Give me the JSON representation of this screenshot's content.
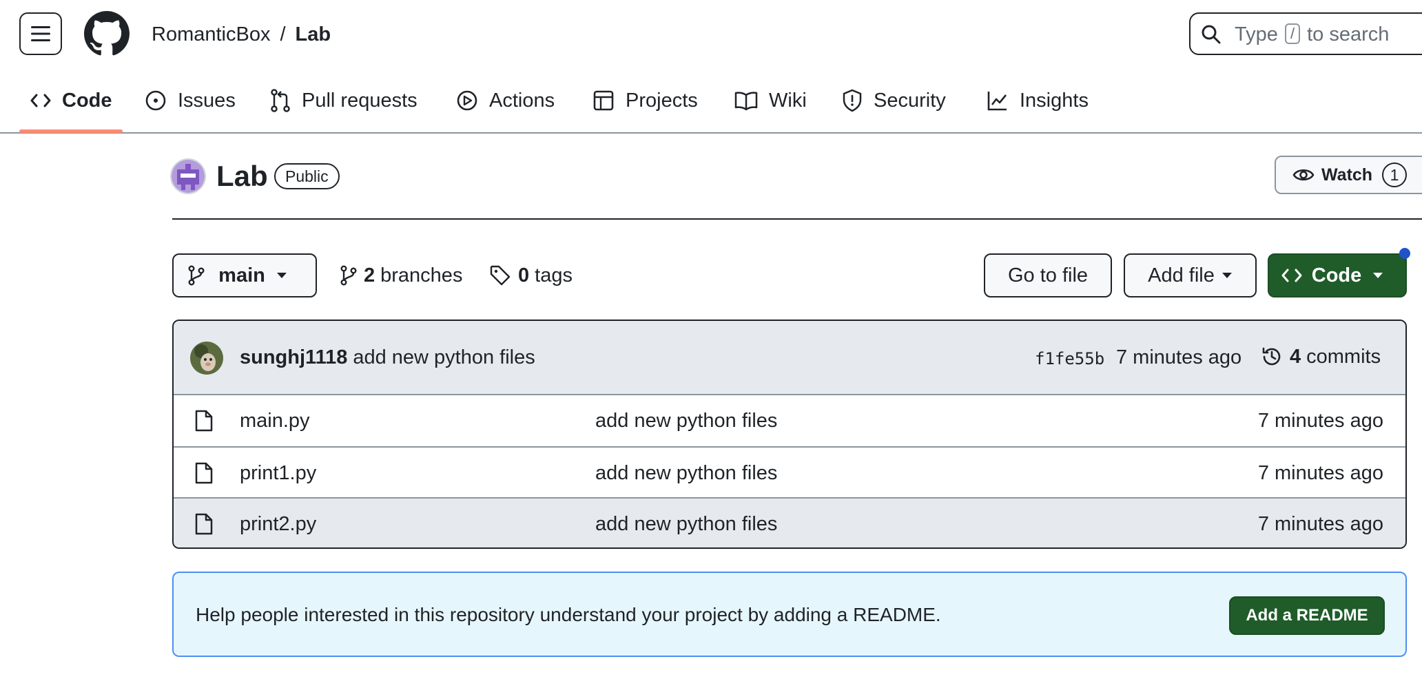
{
  "header": {
    "owner": "RomanticBox",
    "separator": "/",
    "repo": "Lab",
    "search_before": "Type",
    "search_key": "/",
    "search_after": "to search"
  },
  "tabs": [
    {
      "label": "Code",
      "icon": "code-icon",
      "active": true
    },
    {
      "label": "Issues",
      "icon": "issue-opened-icon"
    },
    {
      "label": "Pull requests",
      "icon": "git-pull-request-icon"
    },
    {
      "label": "Actions",
      "icon": "play-icon"
    },
    {
      "label": "Projects",
      "icon": "table-icon"
    },
    {
      "label": "Wiki",
      "icon": "book-icon"
    },
    {
      "label": "Security",
      "icon": "shield-icon"
    },
    {
      "label": "Insights",
      "icon": "graph-icon"
    }
  ],
  "repo": {
    "name": "Lab",
    "visibility": "Public",
    "watch_label": "Watch",
    "watch_count": "1"
  },
  "toolbar": {
    "branch": "main",
    "branches_count": "2",
    "branches_label": "branches",
    "tags_count": "0",
    "tags_label": "tags",
    "goto_file": "Go to file",
    "add_file": "Add file",
    "code": "Code"
  },
  "latest_commit": {
    "author": "sunghj1118",
    "message": "add new python files",
    "sha": "f1fe55b",
    "time": "7 minutes ago",
    "commits_count": "4",
    "commits_label": "commits"
  },
  "files": [
    {
      "name": "main.py",
      "message": "add new python files",
      "time": "7 minutes ago"
    },
    {
      "name": "print1.py",
      "message": "add new python files",
      "time": "7 minutes ago"
    },
    {
      "name": "print2.py",
      "message": "add new python files",
      "time": "7 minutes ago"
    }
  ],
  "readme_banner": {
    "text": "Help people interested in this repository understand your project by adding a README.",
    "button": "Add a README"
  },
  "colors": {
    "primary_button": "#1f5c2a",
    "active_tab_underline": "#fd8c73",
    "notification_dot": "#1f53c7",
    "banner_background": "#e6f6fd",
    "banner_border": "#4d8ff0"
  }
}
